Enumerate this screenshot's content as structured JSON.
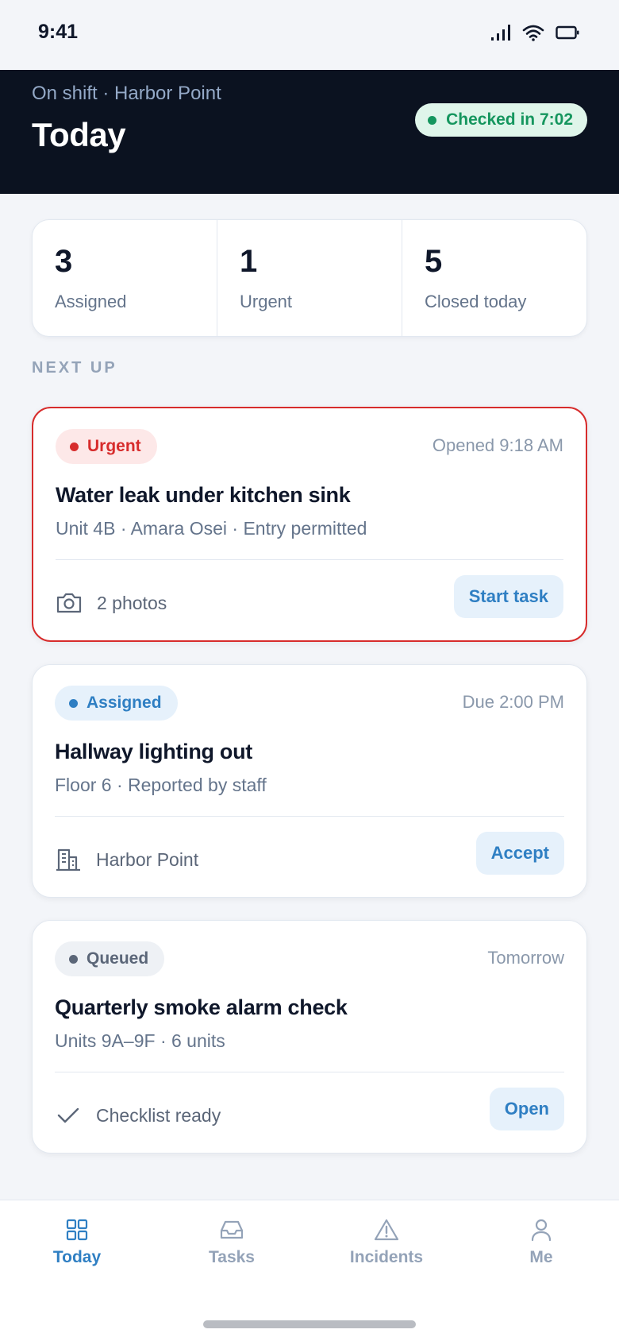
{
  "status_bar": {
    "time": "9:41"
  },
  "header": {
    "subtitle": "On shift · Harbor Point",
    "title": "Today",
    "checkin": "Checked in 7:02",
    "checkin_color": "#15965e"
  },
  "stats": [
    {
      "value": "3",
      "label": "Assigned"
    },
    {
      "value": "1",
      "label": "Urgent"
    },
    {
      "value": "5",
      "label": "Closed today"
    }
  ],
  "section_label": "NEXT UP",
  "tasks": [
    {
      "badge": "Urgent",
      "badge_color": "#d72c2c",
      "time": "Opened 9:18 AM",
      "title": "Water leak under kitchen sink",
      "meta": "Unit 4B · Amara Osei · Entry permitted",
      "footer_icon": "camera-icon",
      "footer_text": "2 photos",
      "action": "Start task"
    },
    {
      "badge": "Assigned",
      "badge_color": "#2f7fc3",
      "time": "Due 2:00 PM",
      "title": "Hallway lighting out",
      "meta": "Floor 6 · Reported by staff",
      "footer_icon": "building-icon",
      "footer_text": "Harbor Point",
      "action": "Accept"
    },
    {
      "badge": "Queued",
      "badge_color": "#5b6678",
      "time": "Tomorrow",
      "title": "Quarterly smoke alarm check",
      "meta": "Units 9A–9F · 6 units",
      "footer_icon": "check-icon",
      "footer_text": "Checklist ready",
      "action": "Open"
    }
  ],
  "nav": [
    {
      "label": "Today",
      "icon": "grid-icon",
      "active": true
    },
    {
      "label": "Tasks",
      "icon": "inbox-icon",
      "active": false
    },
    {
      "label": "Incidents",
      "icon": "warning-icon",
      "active": false
    },
    {
      "label": "Me",
      "icon": "user-icon",
      "active": false
    }
  ],
  "colors": {
    "accent": "#2f7fc3",
    "header_bg": "#0b1220",
    "urgent": "#d72c2c"
  }
}
